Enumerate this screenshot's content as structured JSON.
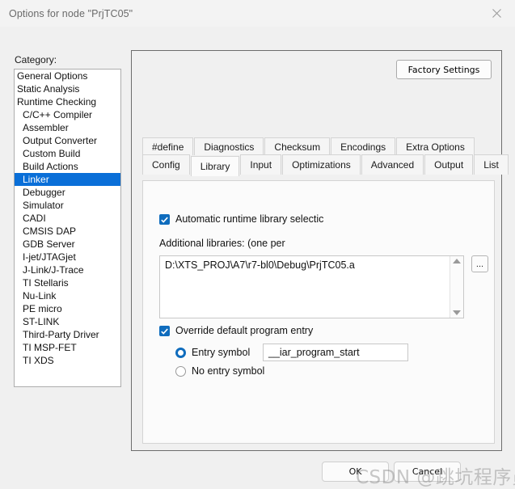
{
  "window": {
    "title": "Options for node \"PrjTC05\"",
    "close_icon": "close-icon"
  },
  "category": {
    "label": "Category:",
    "items": [
      {
        "label": "General Options",
        "selected": false,
        "indent": false
      },
      {
        "label": "Static Analysis",
        "selected": false,
        "indent": false
      },
      {
        "label": "Runtime Checking",
        "selected": false,
        "indent": false
      },
      {
        "label": "C/C++ Compiler",
        "selected": false,
        "indent": true
      },
      {
        "label": "Assembler",
        "selected": false,
        "indent": true
      },
      {
        "label": "Output Converter",
        "selected": false,
        "indent": true
      },
      {
        "label": "Custom Build",
        "selected": false,
        "indent": true
      },
      {
        "label": "Build Actions",
        "selected": false,
        "indent": true
      },
      {
        "label": "Linker",
        "selected": true,
        "indent": true
      },
      {
        "label": "Debugger",
        "selected": false,
        "indent": true
      },
      {
        "label": "Simulator",
        "selected": false,
        "indent": true
      },
      {
        "label": "CADI",
        "selected": false,
        "indent": true
      },
      {
        "label": "CMSIS DAP",
        "selected": false,
        "indent": true
      },
      {
        "label": "GDB Server",
        "selected": false,
        "indent": true
      },
      {
        "label": "I-jet/JTAGjet",
        "selected": false,
        "indent": true
      },
      {
        "label": "J-Link/J-Trace",
        "selected": false,
        "indent": true
      },
      {
        "label": "TI Stellaris",
        "selected": false,
        "indent": true
      },
      {
        "label": "Nu-Link",
        "selected": false,
        "indent": true
      },
      {
        "label": "PE micro",
        "selected": false,
        "indent": true
      },
      {
        "label": "ST-LINK",
        "selected": false,
        "indent": true
      },
      {
        "label": "Third-Party Driver",
        "selected": false,
        "indent": true
      },
      {
        "label": "TI MSP-FET",
        "selected": false,
        "indent": true
      },
      {
        "label": "TI XDS",
        "selected": false,
        "indent": true
      }
    ]
  },
  "panel": {
    "factory_settings_label": "Factory Settings"
  },
  "tabs": {
    "row_top": [
      {
        "label": "#define",
        "selected": false
      },
      {
        "label": "Diagnostics",
        "selected": false
      },
      {
        "label": "Checksum",
        "selected": false
      },
      {
        "label": "Encodings",
        "selected": false
      },
      {
        "label": "Extra Options",
        "selected": false
      }
    ],
    "row_bottom": [
      {
        "label": "Config",
        "selected": false
      },
      {
        "label": "Library",
        "selected": true
      },
      {
        "label": "Input",
        "selected": false
      },
      {
        "label": "Optimizations",
        "selected": false
      },
      {
        "label": "Advanced",
        "selected": false
      },
      {
        "label": "Output",
        "selected": false
      },
      {
        "label": "List",
        "selected": false
      }
    ]
  },
  "library_page": {
    "automatic_runtime": {
      "label": "Automatic runtime library selectic",
      "checked": true
    },
    "additional_libraries": {
      "label": "Additional libraries: (one per",
      "value": "D:\\XTS_PROJ\\A7\\r7-bl0\\Debug\\PrjTC05.a",
      "browse_label": "...",
      "scroll_up_icon": "scroll-up-arrow-icon",
      "scroll_down_icon": "scroll-down-arrow-icon"
    },
    "override_entry": {
      "label": "Override default program entry",
      "checked": true
    },
    "entry_symbol": {
      "label": "Entry symbol",
      "selected": true,
      "value": "__iar_program_start"
    },
    "no_entry_symbol": {
      "label": "No entry symbol",
      "selected": false
    }
  },
  "footer": {
    "ok_label": "OK",
    "cancel_label": "Cancel"
  },
  "watermark": {
    "text": "CSDN @跳坑程序员"
  },
  "colors": {
    "accent": "#0f6cbd",
    "selection": "#0a6fd8",
    "window_bg": "#f0f0f0",
    "panel_bg": "#fbfbfb",
    "field_bg": "#ffffff"
  }
}
